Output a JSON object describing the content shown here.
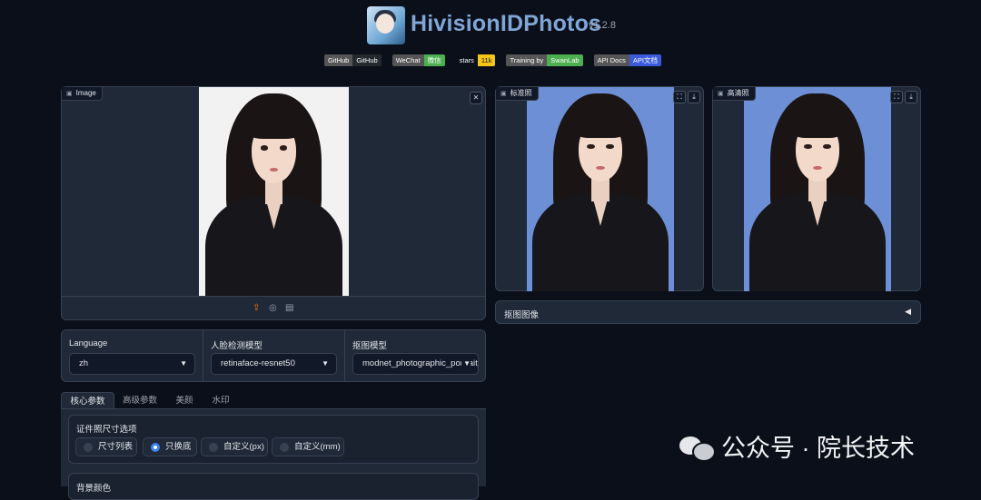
{
  "header": {
    "title": "HivisionIDPhotos",
    "version": "v1.2.8",
    "badges": [
      {
        "left": "GitHub",
        "right": "GitHub",
        "color": "#24292e"
      },
      {
        "left": "WeChat",
        "right": "微信",
        "color": "#4caf50"
      },
      {
        "left": "stars",
        "right": "11k",
        "color": "#f5c518"
      },
      {
        "left": "Training by",
        "right": "SwanLab",
        "color": "#4caf50"
      },
      {
        "left": "API Docs",
        "right": "API文档",
        "color": "#3b5bdb"
      }
    ]
  },
  "input_panel": {
    "label": "Image",
    "photo_background": "#f2f2f2",
    "actions": [
      "upload-icon",
      "webcam-icon",
      "clipboard-icon"
    ]
  },
  "outputs": [
    {
      "label": "标准照",
      "photo_background": "#6c8fd6"
    },
    {
      "label": "高清照",
      "photo_background": "#6c8fd6"
    }
  ],
  "matting_accordion": {
    "label": "抠图图像",
    "arrow": "◀"
  },
  "dropdowns": [
    {
      "label": "Language",
      "value": "zh"
    },
    {
      "label": "人脸检测模型",
      "value": "retinaface-resnet50"
    },
    {
      "label": "抠图模型",
      "value": "modnet_photographic_portrait_matting"
    }
  ],
  "tabs": [
    {
      "label": "核心参数",
      "active": true
    },
    {
      "label": "高级参数",
      "active": false
    },
    {
      "label": "美颜",
      "active": false
    },
    {
      "label": "水印",
      "active": false
    }
  ],
  "size_options": {
    "title": "证件照尺寸选项",
    "options": [
      {
        "label": "尺寸列表",
        "selected": false
      },
      {
        "label": "只换底",
        "selected": true
      },
      {
        "label": "自定义(px)",
        "selected": false
      },
      {
        "label": "自定义(mm)",
        "selected": false
      }
    ]
  },
  "bg_color_section": {
    "title": "背景颜色"
  },
  "watermark": {
    "text": "公众号 · 院长技术"
  }
}
